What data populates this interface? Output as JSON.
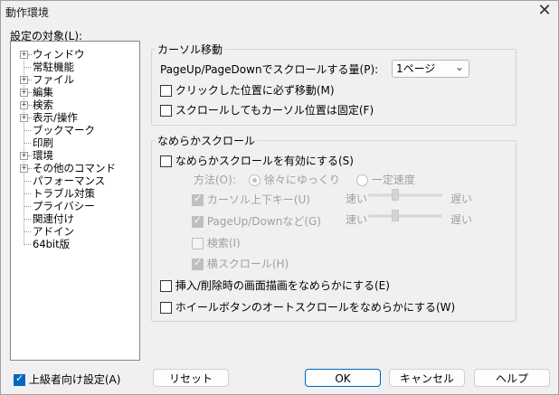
{
  "window": {
    "title": "動作環境",
    "close_glyph": "✕"
  },
  "tree": {
    "label": "設定の対象(L):",
    "items": [
      {
        "label": "ウィンドウ",
        "expandable": true
      },
      {
        "label": "常駐機能",
        "expandable": false
      },
      {
        "label": "ファイル",
        "expandable": true
      },
      {
        "label": "編集",
        "expandable": true
      },
      {
        "label": "検索",
        "expandable": true
      },
      {
        "label": "表示/操作",
        "expandable": true
      },
      {
        "label": "ブックマーク",
        "expandable": false
      },
      {
        "label": "印刷",
        "expandable": false
      },
      {
        "label": "環境",
        "expandable": true
      },
      {
        "label": "その他のコマンド",
        "expandable": true
      },
      {
        "label": "パフォーマンス",
        "expandable": false
      },
      {
        "label": "トラブル対策",
        "expandable": false
      },
      {
        "label": "プライバシー",
        "expandable": false
      },
      {
        "label": "関連付け",
        "expandable": false
      },
      {
        "label": "アドイン",
        "expandable": false
      },
      {
        "label": "64bit版",
        "expandable": false
      }
    ],
    "expand_glyph": "+"
  },
  "cursor_move": {
    "title": "カーソル移動",
    "page_label": "PageUp/PageDownでスクロールする量(P):",
    "page_value": "1ページ",
    "dropdown_glyph": "⌄",
    "click_move": "クリックした位置に必ず移動(M)",
    "scroll_fixed": "スクロールしてもカーソル位置は固定(F)"
  },
  "smooth": {
    "title": "なめらかスクロール",
    "enable": "なめらかスクロールを有効にする(S)",
    "method_label": "方法(O):",
    "method_gradual": "徐々にゆっくり",
    "method_constant": "一定速度",
    "cursor_keys": "カーソル上下キー(U)",
    "pageupdown": "PageUp/Downなど(G)",
    "search": "検索(I)",
    "hscroll": "横スクロール(H)",
    "fast": "速い",
    "slow": "遅い",
    "insert_delete": "挿入/削除時の画面描画をなめらかにする(E)",
    "wheel": "ホイールボタンのオートスクロールをなめらかにする(W)"
  },
  "footer": {
    "advanced": "上級者向け設定(A)",
    "reset": "リセット",
    "ok": "OK",
    "cancel": "キャンセル",
    "help": "ヘルプ"
  }
}
